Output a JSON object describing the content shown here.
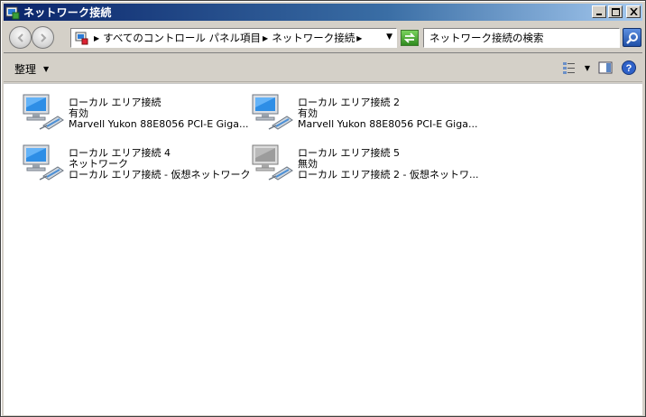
{
  "window": {
    "title": "ネットワーク接続"
  },
  "address": {
    "crumbs": [
      "すべてのコントロール パネル項目",
      "ネットワーク接続"
    ]
  },
  "search": {
    "placeholder": "ネットワーク接続の検索"
  },
  "toolbar": {
    "organize_label": "整理"
  },
  "connections": [
    {
      "name": "ローカル エリア接続",
      "status": "有効",
      "device": "Marvell Yukon 88E8056 PCI-E Giga...",
      "disabled": false
    },
    {
      "name": "ローカル エリア接続 2",
      "status": "有効",
      "device": "Marvell Yukon 88E8056 PCI-E Giga...",
      "disabled": false
    },
    {
      "name": "ローカル エリア接続 4",
      "status": "ネットワーク",
      "device": "ローカル エリア接続 - 仮想ネットワーク",
      "disabled": false
    },
    {
      "name": "ローカル エリア接続 5",
      "status": "無効",
      "device": "ローカル エリア接続 2 - 仮想ネットワ...",
      "disabled": true
    }
  ],
  "colors": {
    "title_bar_start": "#0a246a",
    "title_bar_end": "#a6caf0",
    "chrome": "#d4d0c8"
  },
  "icons": {
    "title": "network-folder-icon",
    "back": "back-arrow-icon",
    "forward": "forward-arrow-icon",
    "refresh": "refresh-icon",
    "search": "magnifier-icon"
  }
}
